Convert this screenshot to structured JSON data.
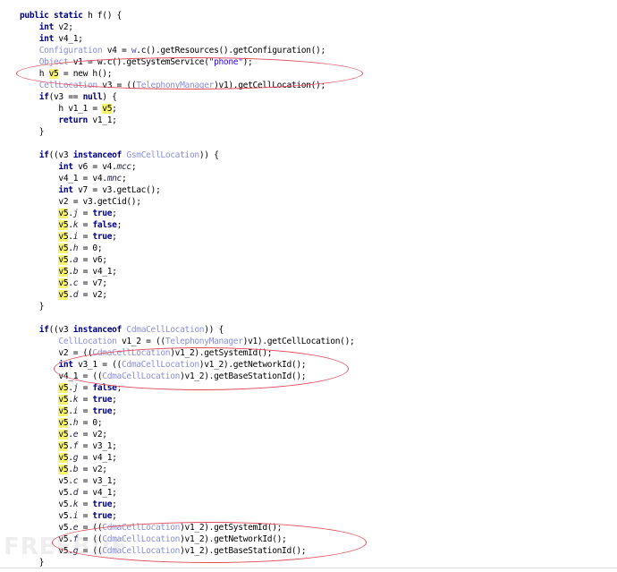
{
  "lines": [
    {
      "indent": 0,
      "segs": [
        [
          "kw",
          "public"
        ],
        [
          "p",
          " "
        ],
        [
          "kw",
          "static"
        ],
        [
          "p",
          " h f() {"
        ]
      ]
    },
    {
      "indent": 1,
      "segs": [
        [
          "kw",
          "int"
        ],
        [
          "p",
          " v2;"
        ]
      ]
    },
    {
      "indent": 1,
      "segs": [
        [
          "kw",
          "int"
        ],
        [
          "p",
          " v4_1;"
        ]
      ]
    },
    {
      "indent": 1,
      "segs": [
        [
          "typ",
          "Configuration"
        ],
        [
          "p",
          " v4 = "
        ],
        [
          "cls",
          "w"
        ],
        [
          "p",
          ".c().getResources().getConfiguration();"
        ]
      ]
    },
    {
      "indent": 1,
      "segs": [
        [
          "typ",
          "Object"
        ],
        [
          "p",
          " v1 = w.c().getSystemService("
        ],
        [
          "str",
          "\"phone\""
        ],
        [
          "p",
          ");"
        ]
      ]
    },
    {
      "indent": 1,
      "segs": [
        [
          "p",
          "h "
        ],
        [
          "hl",
          "v5"
        ],
        [
          "p",
          " = new h();"
        ]
      ]
    },
    {
      "indent": 1,
      "segs": [
        [
          "typ",
          "CellLocation"
        ],
        [
          "p",
          " v3 = (("
        ],
        [
          "typ",
          "TelephonyManager"
        ],
        [
          "p",
          ")v1).getCellLocation();"
        ]
      ]
    },
    {
      "indent": 1,
      "segs": [
        [
          "kw",
          "if"
        ],
        [
          "p",
          "(v3 == "
        ],
        [
          "kw",
          "null"
        ],
        [
          "p",
          ") {"
        ]
      ]
    },
    {
      "indent": 2,
      "segs": [
        [
          "p",
          "h v1_1 = "
        ],
        [
          "hl",
          "v5"
        ],
        [
          "p",
          ";"
        ]
      ]
    },
    {
      "indent": 2,
      "segs": [
        [
          "kw",
          "return"
        ],
        [
          "p",
          " v1_1;"
        ]
      ]
    },
    {
      "indent": 1,
      "segs": [
        [
          "p",
          "}"
        ]
      ]
    },
    {
      "indent": 0,
      "segs": []
    },
    {
      "indent": 1,
      "segs": [
        [
          "kw",
          "if"
        ],
        [
          "p",
          "((v3 "
        ],
        [
          "kw",
          "instanceof"
        ],
        [
          "p",
          " "
        ],
        [
          "typ",
          "GsmCellLocation"
        ],
        [
          "p",
          ")) {"
        ]
      ]
    },
    {
      "indent": 2,
      "segs": [
        [
          "kw",
          "int"
        ],
        [
          "p",
          " v6 = v4."
        ],
        [
          "fld",
          "mcc"
        ],
        [
          "p",
          ";"
        ]
      ]
    },
    {
      "indent": 2,
      "segs": [
        [
          "p",
          "v4_1 = v4."
        ],
        [
          "fld",
          "mnc"
        ],
        [
          "p",
          ";"
        ]
      ]
    },
    {
      "indent": 2,
      "segs": [
        [
          "kw",
          "int"
        ],
        [
          "p",
          " v7 = v3.getLac();"
        ]
      ]
    },
    {
      "indent": 2,
      "segs": [
        [
          "p",
          "v2 = v3.getCid();"
        ]
      ]
    },
    {
      "indent": 2,
      "segs": [
        [
          "hl",
          "v5"
        ],
        [
          "p",
          "."
        ],
        [
          "fld",
          "j"
        ],
        [
          "p",
          " = "
        ],
        [
          "kw",
          "true"
        ],
        [
          "p",
          ";"
        ]
      ]
    },
    {
      "indent": 2,
      "segs": [
        [
          "hl",
          "v5"
        ],
        [
          "p",
          "."
        ],
        [
          "fld",
          "k"
        ],
        [
          "p",
          " = "
        ],
        [
          "kw",
          "false"
        ],
        [
          "p",
          ";"
        ]
      ]
    },
    {
      "indent": 2,
      "segs": [
        [
          "hl",
          "v5"
        ],
        [
          "p",
          "."
        ],
        [
          "fld",
          "i"
        ],
        [
          "p",
          " = "
        ],
        [
          "kw",
          "true"
        ],
        [
          "p",
          ";"
        ]
      ]
    },
    {
      "indent": 2,
      "segs": [
        [
          "hl",
          "v5"
        ],
        [
          "p",
          "."
        ],
        [
          "fld",
          "h"
        ],
        [
          "p",
          " = 0;"
        ]
      ]
    },
    {
      "indent": 2,
      "segs": [
        [
          "hl",
          "v5"
        ],
        [
          "p",
          "."
        ],
        [
          "fld",
          "a"
        ],
        [
          "p",
          " = v6;"
        ]
      ]
    },
    {
      "indent": 2,
      "segs": [
        [
          "hl",
          "v5"
        ],
        [
          "p",
          "."
        ],
        [
          "fld",
          "b"
        ],
        [
          "p",
          " = v4_1;"
        ]
      ]
    },
    {
      "indent": 2,
      "segs": [
        [
          "hl",
          "v5"
        ],
        [
          "p",
          "."
        ],
        [
          "fld",
          "c"
        ],
        [
          "p",
          " = v7;"
        ]
      ]
    },
    {
      "indent": 2,
      "segs": [
        [
          "hl",
          "v5"
        ],
        [
          "p",
          "."
        ],
        [
          "fld",
          "d"
        ],
        [
          "p",
          " = v2;"
        ]
      ]
    },
    {
      "indent": 1,
      "segs": [
        [
          "p",
          "}"
        ]
      ]
    },
    {
      "indent": 0,
      "segs": []
    },
    {
      "indent": 1,
      "segs": [
        [
          "kw",
          "if"
        ],
        [
          "p",
          "((v3 "
        ],
        [
          "kw",
          "instanceof"
        ],
        [
          "p",
          " "
        ],
        [
          "typ",
          "CdmaCellLocation"
        ],
        [
          "p",
          ")) {"
        ]
      ]
    },
    {
      "indent": 2,
      "segs": [
        [
          "typ",
          "CellLocation"
        ],
        [
          "p",
          " v1_2 = (("
        ],
        [
          "typ",
          "TelephonyManager"
        ],
        [
          "p",
          ")v1).getCellLocation();"
        ]
      ]
    },
    {
      "indent": 2,
      "segs": [
        [
          "p",
          "v2 = (("
        ],
        [
          "typ",
          "CdmaCellLocation"
        ],
        [
          "p",
          ")v1_2).getSystemId();"
        ]
      ]
    },
    {
      "indent": 2,
      "segs": [
        [
          "kw",
          "int"
        ],
        [
          "p",
          " v3_1 = (("
        ],
        [
          "typ",
          "CdmaCellLocation"
        ],
        [
          "p",
          ")v1_2).getNetworkId();"
        ]
      ]
    },
    {
      "indent": 2,
      "segs": [
        [
          "p",
          "v4_1 = (("
        ],
        [
          "typ",
          "CdmaCellLocation"
        ],
        [
          "p",
          ")v1_2).getBaseStationId();"
        ]
      ]
    },
    {
      "indent": 2,
      "segs": [
        [
          "hl",
          "v5"
        ],
        [
          "p",
          "."
        ],
        [
          "fld",
          "j"
        ],
        [
          "p",
          " = "
        ],
        [
          "kw",
          "false"
        ],
        [
          "p",
          ";"
        ]
      ]
    },
    {
      "indent": 2,
      "segs": [
        [
          "hl",
          "v5"
        ],
        [
          "p",
          "."
        ],
        [
          "fld",
          "k"
        ],
        [
          "p",
          " = "
        ],
        [
          "kw",
          "true"
        ],
        [
          "p",
          ";"
        ]
      ]
    },
    {
      "indent": 2,
      "segs": [
        [
          "hl",
          "v5"
        ],
        [
          "p",
          "."
        ],
        [
          "fld",
          "i"
        ],
        [
          "p",
          " = "
        ],
        [
          "kw",
          "true"
        ],
        [
          "p",
          ";"
        ]
      ]
    },
    {
      "indent": 2,
      "segs": [
        [
          "hl",
          "v5"
        ],
        [
          "p",
          "."
        ],
        [
          "fld",
          "h"
        ],
        [
          "p",
          " = 0;"
        ]
      ]
    },
    {
      "indent": 2,
      "segs": [
        [
          "hl",
          "v5"
        ],
        [
          "p",
          "."
        ],
        [
          "fld",
          "e"
        ],
        [
          "p",
          " = v2;"
        ]
      ]
    },
    {
      "indent": 2,
      "segs": [
        [
          "hl",
          "v5"
        ],
        [
          "p",
          "."
        ],
        [
          "fld",
          "f"
        ],
        [
          "p",
          " = v3_1;"
        ]
      ]
    },
    {
      "indent": 2,
      "segs": [
        [
          "hl",
          "v5"
        ],
        [
          "p",
          "."
        ],
        [
          "fld",
          "g"
        ],
        [
          "p",
          " = v4_1;"
        ]
      ]
    },
    {
      "indent": 2,
      "segs": [
        [
          "hl",
          "v5"
        ],
        [
          "p",
          "."
        ],
        [
          "fld",
          "b"
        ],
        [
          "p",
          " = v2;"
        ]
      ]
    },
    {
      "indent": 2,
      "segs": [
        [
          "p",
          "v5."
        ],
        [
          "fld",
          "c"
        ],
        [
          "p",
          " = v3_1;"
        ]
      ]
    },
    {
      "indent": 2,
      "segs": [
        [
          "p",
          "v5."
        ],
        [
          "fld",
          "d"
        ],
        [
          "p",
          " = v4_1;"
        ]
      ]
    },
    {
      "indent": 2,
      "segs": [
        [
          "p",
          "v5."
        ],
        [
          "fld",
          "k"
        ],
        [
          "p",
          " = "
        ],
        [
          "kw",
          "true"
        ],
        [
          "p",
          ";"
        ]
      ]
    },
    {
      "indent": 2,
      "segs": [
        [
          "p",
          "v5."
        ],
        [
          "fld",
          "i"
        ],
        [
          "p",
          " = "
        ],
        [
          "kw",
          "true"
        ],
        [
          "p",
          ";"
        ]
      ]
    },
    {
      "indent": 2,
      "segs": [
        [
          "p",
          "v5."
        ],
        [
          "fld",
          "e"
        ],
        [
          "p",
          " = (("
        ],
        [
          "typ",
          "CdmaCellLocation"
        ],
        [
          "p",
          ")v1_2).getSystemId();"
        ]
      ]
    },
    {
      "indent": 2,
      "segs": [
        [
          "p",
          "v5."
        ],
        [
          "fld",
          "f"
        ],
        [
          "p",
          " = (("
        ],
        [
          "typ",
          "CdmaCellLocation"
        ],
        [
          "p",
          ")v1_2).getNetworkId();"
        ]
      ]
    },
    {
      "indent": 2,
      "segs": [
        [
          "p",
          "v5."
        ],
        [
          "fld",
          "g"
        ],
        [
          "p",
          " = (("
        ],
        [
          "typ",
          "CdmaCellLocation"
        ],
        [
          "p",
          ")v1_2).getBaseStationId();"
        ]
      ]
    },
    {
      "indent": 1,
      "segs": [
        [
          "p",
          "}"
        ]
      ]
    }
  ],
  "annotation_color": "#e24a5a",
  "highlight_color": "#f7f470",
  "watermark": "FREEBUF"
}
